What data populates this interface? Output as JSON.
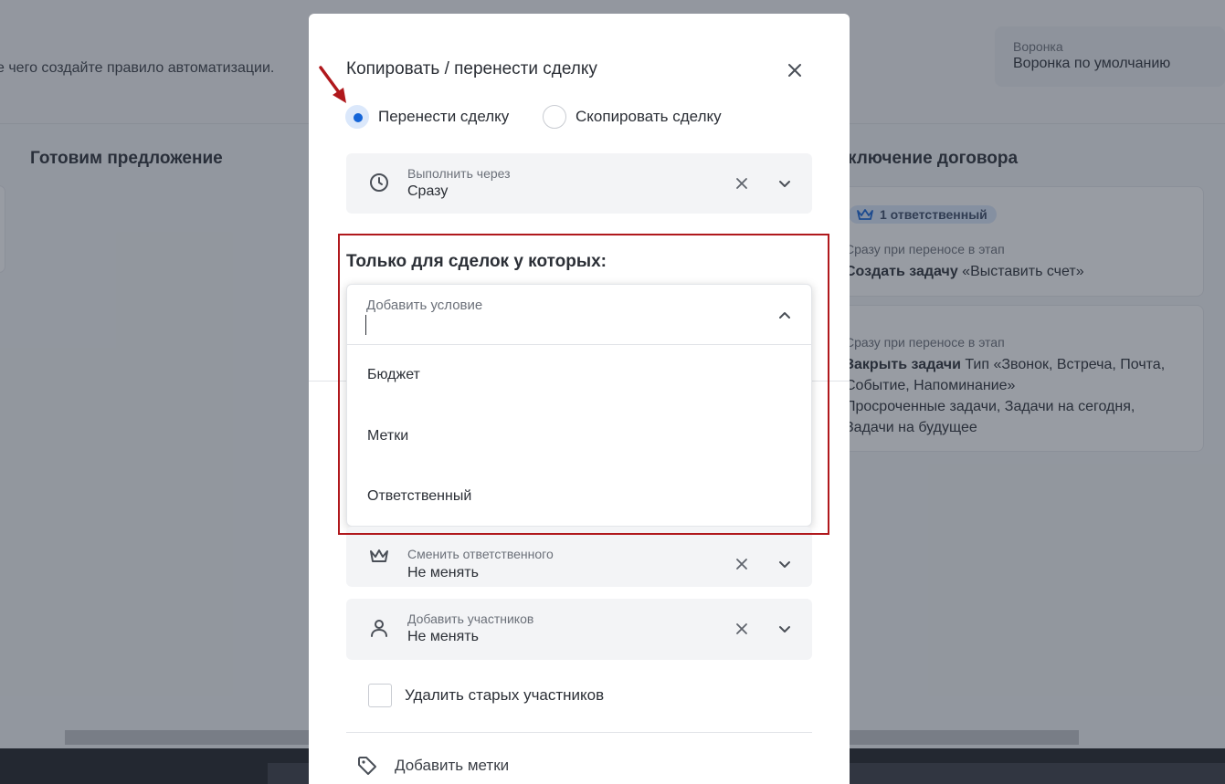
{
  "background": {
    "hint_text": "е чего создайте правило автоматизации.",
    "funnel": {
      "label": "Воронка",
      "value": "Воронка по умолчанию"
    },
    "columns": [
      {
        "title": "Готовим предложение"
      },
      {
        "title": "ключение договора"
      }
    ],
    "card1": {
      "badge": "1 ответственный",
      "trigger": "Сразу при переносе в этап",
      "action_bold": "Создать задачу",
      "action_rest": " «Выставить счет»"
    },
    "card2": {
      "trigger": "Сразу при переносе в этап",
      "line1_bold": "Закрыть задачи",
      "line1_rest": " Тип «Звонок, Встреча, Почта,",
      "line2": "Событие, Напоминание»",
      "line3": "Просроченные задачи, Задачи на сегодня,",
      "line4": "Задачи на будущее"
    }
  },
  "modal": {
    "title": "Копировать / перенести сделку",
    "radios": [
      {
        "label": "Перенести сделку",
        "selected": true
      },
      {
        "label": "Скопировать сделку",
        "selected": false
      }
    ],
    "execute": {
      "label": "Выполнить через",
      "value": "Сразу"
    },
    "conditions_title": "Только для сделок у которых:",
    "condition_dropdown": {
      "label": "Добавить условие",
      "input_value": "",
      "options": [
        "Бюджет",
        "Метки",
        "Ответственный"
      ]
    },
    "responsible": {
      "label": "Сменить ответственного",
      "value": "Не менять"
    },
    "participants": {
      "label": "Добавить участников",
      "value": "Не менять"
    },
    "remove_old_participants": {
      "label": "Удалить старых участников",
      "checked": false
    },
    "add_tags": {
      "label": "Добавить метки"
    }
  },
  "colors": {
    "accent": "#1565d8",
    "highlight": "#b0181c",
    "badge_bg": "#dbe8fb"
  }
}
